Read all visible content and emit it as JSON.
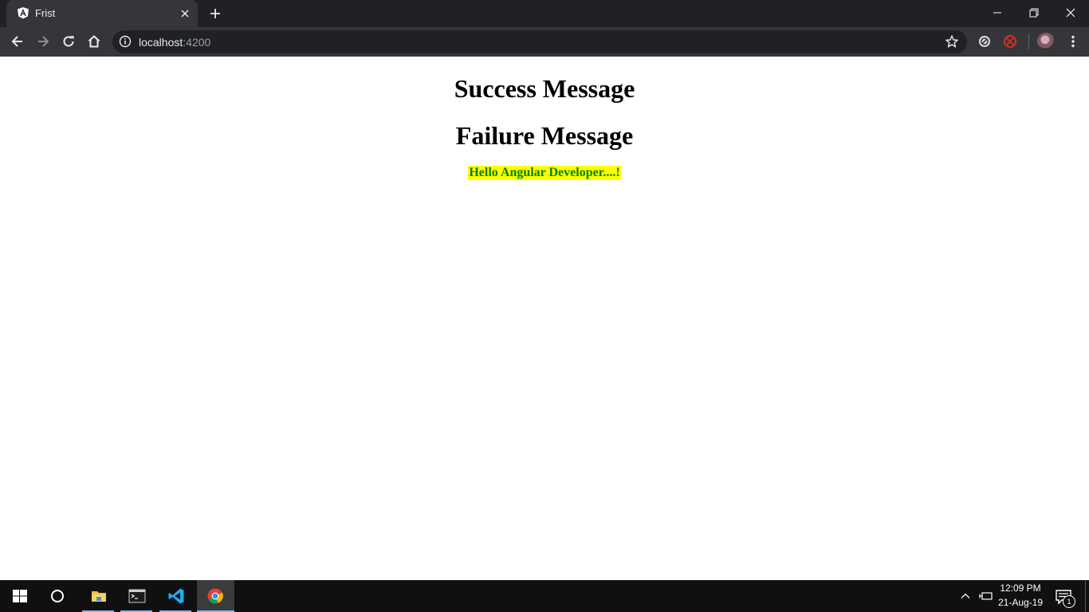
{
  "browser": {
    "tab": {
      "title": "Frist",
      "favicon": "angular-icon"
    },
    "address": {
      "host": "localhost",
      "port": ":4200"
    },
    "colors": {
      "frame": "#202124",
      "toolbar": "#35363a"
    }
  },
  "page": {
    "success_heading": "Success Message",
    "failure_heading": "Failure Message",
    "hello_text": "Hello Angular Developer....!",
    "colors": {
      "hello_text": "#008000",
      "hello_background": "#ffff00"
    }
  },
  "taskbar": {
    "apps": [
      "file-explorer-icon",
      "terminal-icon",
      "vscode-icon",
      "chrome-icon"
    ],
    "clock": {
      "time": "12:09 PM",
      "date": "21-Aug-19"
    },
    "notification_count": "1"
  }
}
